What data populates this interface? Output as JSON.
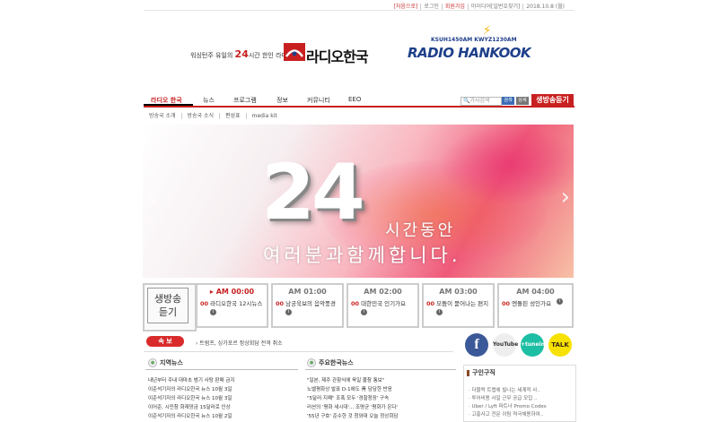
{
  "toplinks": [
    "[처음으로]",
    "로그인",
    "회원가입",
    "마이디어[일번호찾기]",
    "2018.10.8 (월)"
  ],
  "header": {
    "tagline_pre": "워싱턴주 유일의",
    "tagline_num": "24",
    "tagline_post": "시간 한인 라디오",
    "logo_ko": "라디오한국",
    "logo_en": "RADIO HANKOOK",
    "freq": "KSUH1450AM KWYZ1230AM"
  },
  "nav": {
    "items": [
      "라디오 한국",
      "뉴스",
      "프로그램",
      "정보",
      "커뮤니티",
      "EEO"
    ],
    "search_placeholder": "가사검색",
    "search_btn": "검색",
    "detail_btn": "상세",
    "live_btn": "생방송듣기"
  },
  "subnav": [
    "방송국 소개",
    "방송국 소식",
    "편성표",
    "media kit"
  ],
  "hero": {
    "big": "24",
    "line1": "시간동안",
    "line2": "여러분과함께합니다."
  },
  "schedule": {
    "live_label_1": "생방송",
    "live_label_2": "듣기",
    "slots": [
      {
        "time": "AM 00:00",
        "num": "00",
        "title": "라디오한국 12시뉴스",
        "now": true
      },
      {
        "time": "AM 01:00",
        "num": "00",
        "title": "남궁욱보의 음악풍경",
        "now": false
      },
      {
        "time": "AM 02:00",
        "num": "00",
        "title": "대한민국 인기가요",
        "now": false
      },
      {
        "time": "AM 03:00",
        "num": "00",
        "title": "모둠이 묻어나는 편지",
        "now": false
      },
      {
        "time": "AM 04:00",
        "num": "00",
        "title": "엔돌핀 성인가요",
        "now": false
      }
    ]
  },
  "breaking": {
    "tag": "속 보",
    "text": "› 트럼프, 싱가포르 정상회담 전격 취소"
  },
  "social": {
    "facebook": "f",
    "youtube": "YouTube",
    "tunein": "+tunein",
    "talk": "TALK"
  },
  "local_news": {
    "title": "지역뉴스",
    "items": [
      "내년부터 주내 대마초 범기 사탕 판매 금지",
      "이준석기자의 라디오한국 뉴스 10월 3일",
      "이준석기자의 라디오한국 뉴스 10월 3일",
      "이어준, 시민참 화재망금 15달러로 인상",
      "이준석기자의 라디오한국 뉴스 10월 2일"
    ]
  },
  "korea_news": {
    "title": "주요한국뉴스",
    "items": [
      "\"일본, 제주 관함식에 욱일 불참 통보\"",
      "노벨평화상 발표 D-1에도 靑 담담한 반응",
      "\"5달러 지폐\" 조폭 모두 '경찰청장' 구속",
      "러션의 '평화 새시대'... 조명균 '평화가 온다'",
      "'55년 구호' 준수한 것 청와대 오늘 정상회담"
    ]
  },
  "jobs": {
    "title": "구인구직",
    "items": [
      "· 더블럭 트랩에 빌나는 세계적 사..",
      "· 투어비용 사일 근무 공급 모집 ..",
      "· Uber / Lyft 파트너 Promo Codes",
      "· 고홍사고 전문 이팀 적극채용하여.."
    ]
  },
  "colors": {
    "accent": "#c82020",
    "navy": "#1e3f8a"
  }
}
